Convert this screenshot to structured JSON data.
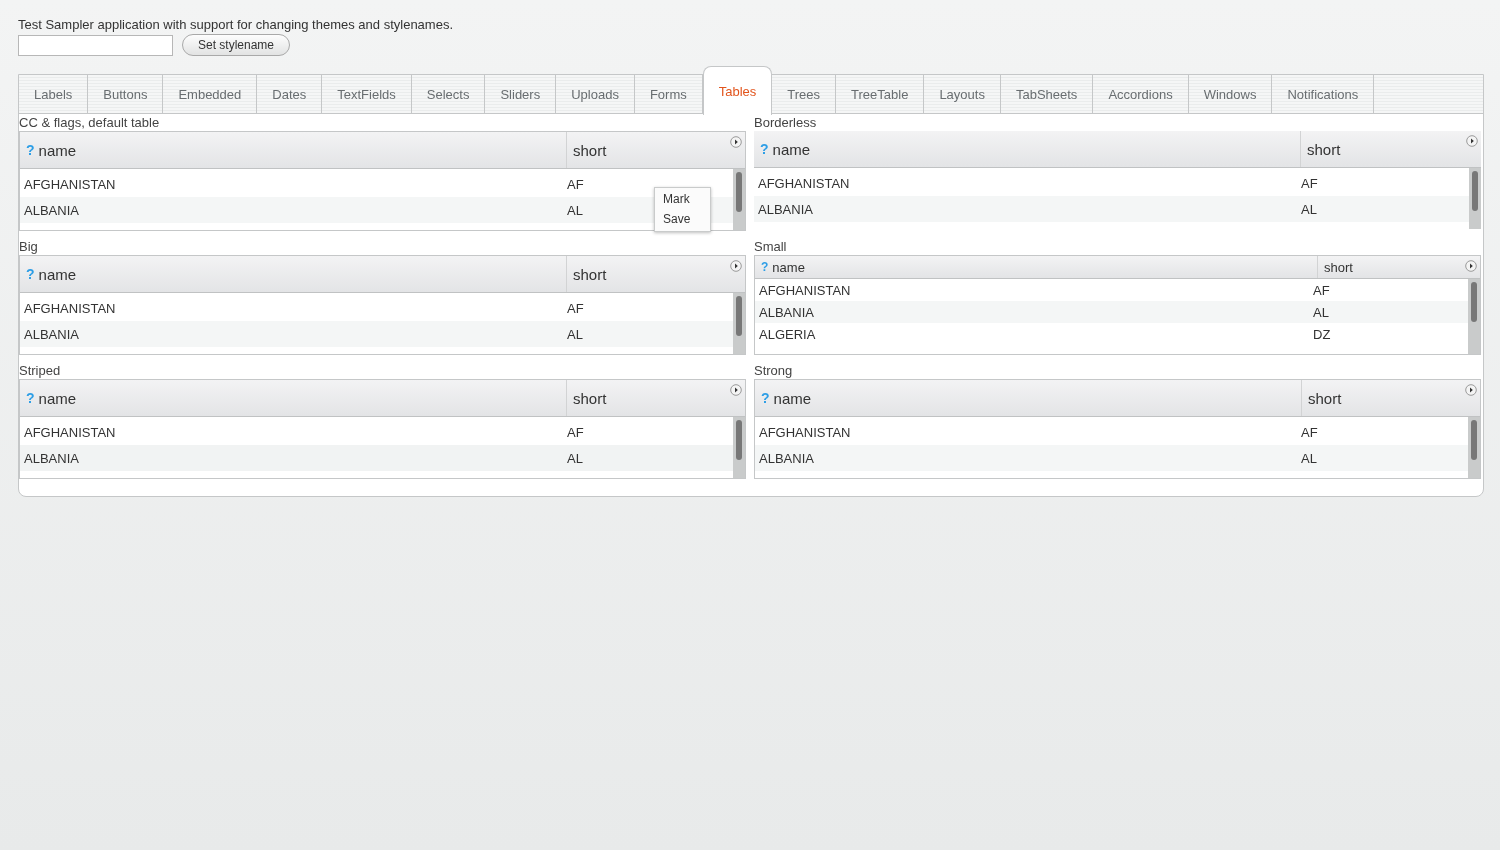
{
  "intro": "Test Sampler application with support for changing themes and stylenames.",
  "stylename_button": "Set stylename",
  "tabs": [
    {
      "label": "Labels",
      "selected": false
    },
    {
      "label": "Buttons",
      "selected": false
    },
    {
      "label": "Embedded",
      "selected": false
    },
    {
      "label": "Dates",
      "selected": false
    },
    {
      "label": "TextFields",
      "selected": false
    },
    {
      "label": "Selects",
      "selected": false
    },
    {
      "label": "Sliders",
      "selected": false
    },
    {
      "label": "Uploads",
      "selected": false
    },
    {
      "label": "Forms",
      "selected": false
    },
    {
      "label": "Tables",
      "selected": true
    },
    {
      "label": "Trees",
      "selected": false
    },
    {
      "label": "TreeTable",
      "selected": false
    },
    {
      "label": "Layouts",
      "selected": false
    },
    {
      "label": "TabSheets",
      "selected": false
    },
    {
      "label": "Accordions",
      "selected": false
    },
    {
      "label": "Windows",
      "selected": false
    },
    {
      "label": "Notifications",
      "selected": false
    }
  ],
  "tables": [
    {
      "caption": "CC & flags, default table",
      "kind": "default",
      "columns": [
        {
          "icon": "?",
          "label": "name"
        },
        {
          "label": "short"
        }
      ],
      "rows": [
        [
          "AFGHANISTAN",
          "AF"
        ],
        [
          "ALBANIA",
          "AL"
        ]
      ],
      "context_menu": [
        "Mark",
        "Save"
      ]
    },
    {
      "caption": "Borderless",
      "kind": "borderless",
      "columns": [
        {
          "icon": "?",
          "label": "name"
        },
        {
          "label": "short"
        }
      ],
      "rows": [
        [
          "AFGHANISTAN",
          "AF"
        ],
        [
          "ALBANIA",
          "AL"
        ]
      ]
    },
    {
      "caption": "Big",
      "kind": "big",
      "columns": [
        {
          "icon": "?",
          "label": "name"
        },
        {
          "label": "short"
        }
      ],
      "rows": [
        [
          "AFGHANISTAN",
          "AF"
        ],
        [
          "ALBANIA",
          "AL"
        ]
      ]
    },
    {
      "caption": "Small",
      "kind": "small",
      "columns": [
        {
          "icon": "?",
          "label": "name"
        },
        {
          "label": "short"
        }
      ],
      "rows": [
        [
          "AFGHANISTAN",
          "AF"
        ],
        [
          "ALBANIA",
          "AL"
        ],
        [
          "ALGERIA",
          "DZ"
        ]
      ]
    },
    {
      "caption": "Striped",
      "kind": "striped",
      "columns": [
        {
          "icon": "?",
          "label": "name"
        },
        {
          "label": "short"
        }
      ],
      "rows": [
        [
          "AFGHANISTAN",
          "AF"
        ],
        [
          "ALBANIA",
          "AL"
        ]
      ]
    },
    {
      "caption": "Strong",
      "kind": "strong",
      "columns": [
        {
          "icon": "?",
          "label": "name"
        },
        {
          "label": "short"
        }
      ],
      "rows": [
        [
          "AFGHANISTAN",
          "AF"
        ],
        [
          "ALBANIA",
          "AL"
        ]
      ]
    }
  ]
}
